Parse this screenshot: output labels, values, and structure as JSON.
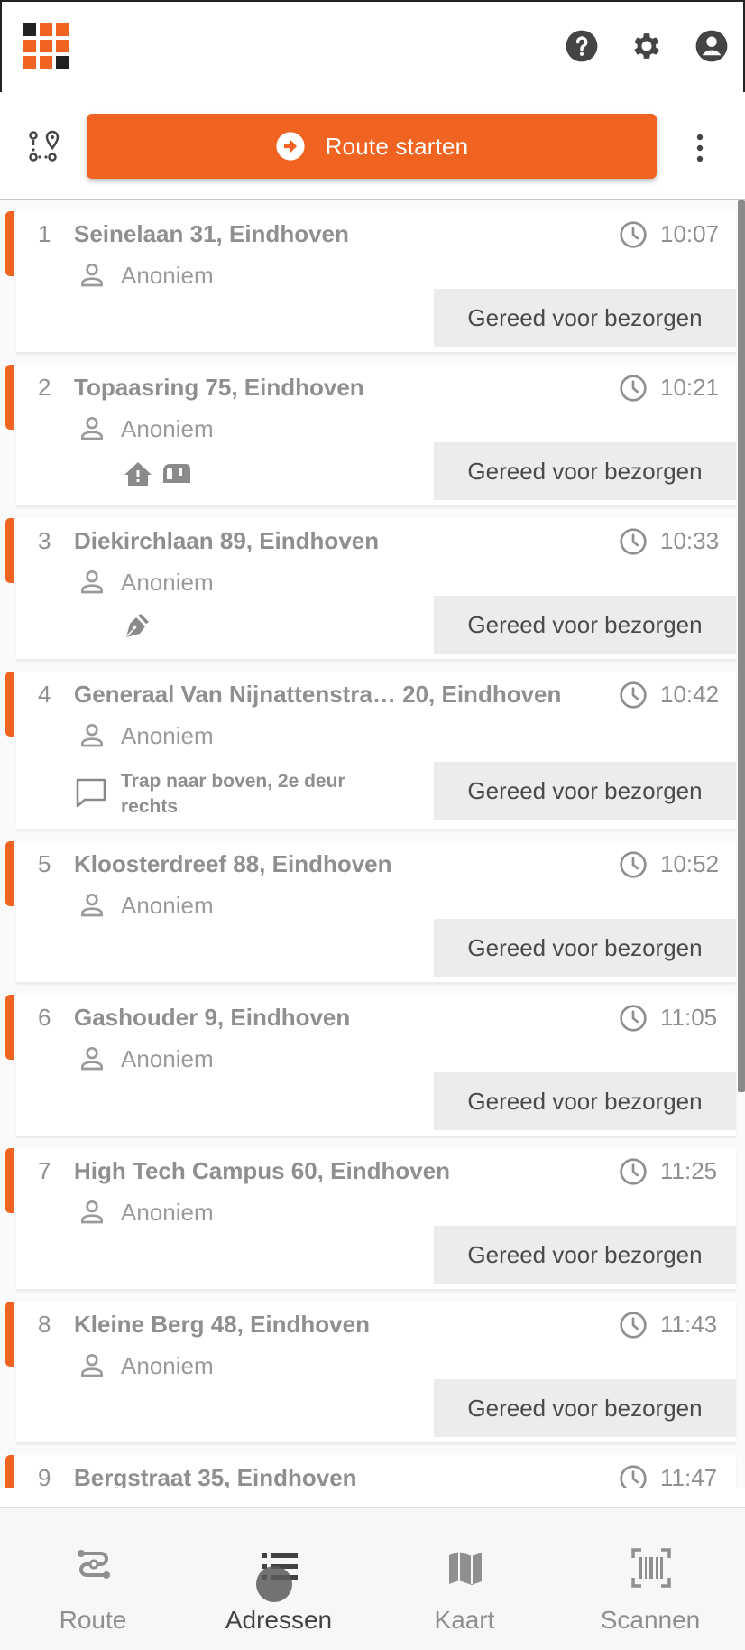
{
  "colors": {
    "accent": "#f06320",
    "icon_dark": "#444444",
    "muted": "#8f8f8f"
  },
  "header": {
    "logo": "orange-grid-logo",
    "icons": [
      "help-icon",
      "settings-icon",
      "account-icon"
    ]
  },
  "actions": {
    "route_toggle_icon": "route-points-icon",
    "start_label": "Route starten",
    "more_icon": "more-vert-icon"
  },
  "stops": [
    {
      "number": "1",
      "address": "Seinelaan 31, Eindhoven",
      "time": "10:07",
      "recipient": "Anoniem",
      "status": "Gereed voor bezorgen"
    },
    {
      "number": "2",
      "address": "Topaasring 75, Eindhoven",
      "time": "10:21",
      "recipient": "Anoniem",
      "status": "Gereed voor bezorgen",
      "badges": [
        "house-alert-icon",
        "mailbox-icon"
      ]
    },
    {
      "number": "3",
      "address": "Diekirchlaan 89, Eindhoven",
      "time": "10:33",
      "recipient": "Anoniem",
      "status": "Gereed voor bezorgen",
      "badges": [
        "signature-pen-icon"
      ]
    },
    {
      "number": "4",
      "address": "Generaal Van Nijnattenstra… 20, Eindhoven",
      "time": "10:42",
      "recipient": "Anoniem",
      "status": "Gereed voor bezorgen",
      "note": "Trap naar boven, 2e deur rechts"
    },
    {
      "number": "5",
      "address": "Kloosterdreef 88, Eindhoven",
      "time": "10:52",
      "recipient": "Anoniem",
      "status": "Gereed voor bezorgen"
    },
    {
      "number": "6",
      "address": "Gashouder 9, Eindhoven",
      "time": "11:05",
      "recipient": "Anoniem",
      "status": "Gereed voor bezorgen"
    },
    {
      "number": "7",
      "address": "High Tech Campus 60, Eindhoven",
      "time": "11:25",
      "recipient": "Anoniem",
      "status": "Gereed voor bezorgen"
    },
    {
      "number": "8",
      "address": "Kleine Berg 48, Eindhoven",
      "time": "11:43",
      "recipient": "Anoniem",
      "status": "Gereed voor bezorgen"
    },
    {
      "number": "9",
      "address": "Bergstraat 35, Eindhoven",
      "time": "11:47"
    }
  ],
  "nav": [
    {
      "label": "Route",
      "icon": "route-icon",
      "active": false
    },
    {
      "label": "Adressen",
      "icon": "list-icon",
      "active": true
    },
    {
      "label": "Kaart",
      "icon": "map-icon",
      "active": false
    },
    {
      "label": "Scannen",
      "icon": "barcode-scan-icon",
      "active": false
    }
  ]
}
